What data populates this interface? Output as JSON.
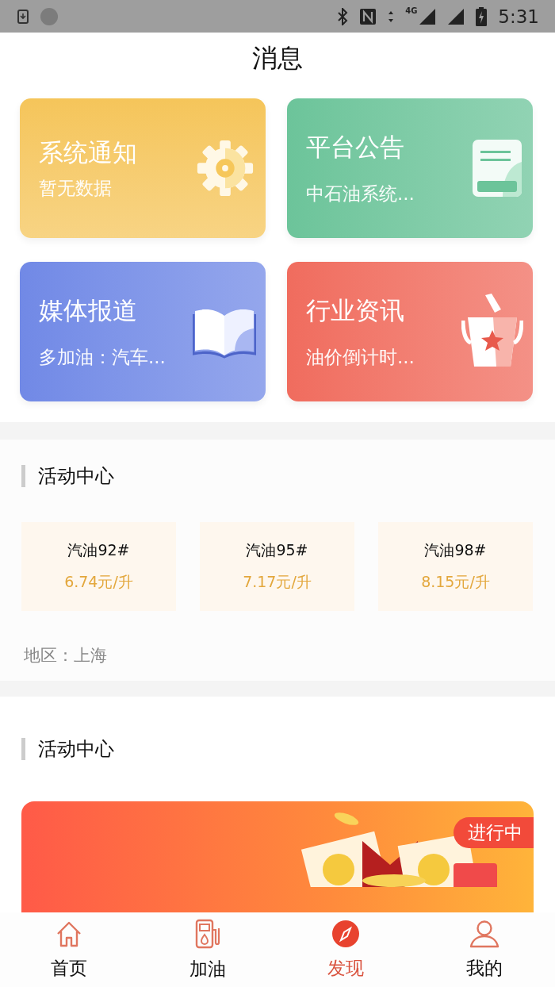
{
  "status_bar": {
    "network": "4G",
    "time": "5:31"
  },
  "title": "消息",
  "message_cards": [
    {
      "title": "系统通知",
      "subtitle": "暂无数据",
      "kind": "gear",
      "color": "#f5c55a"
    },
    {
      "title": "平台公告",
      "subtitle": "中石油系统...",
      "kind": "document",
      "color": "#6cc49a"
    },
    {
      "title": "媒体报道",
      "subtitle": "多加油：汽车...",
      "kind": "book",
      "color": "#7189e6"
    },
    {
      "title": "行业资讯",
      "subtitle": "油价倒计时...",
      "kind": "bucket",
      "color": "#f06c5e"
    }
  ],
  "fuel_section": {
    "heading": "活动中心",
    "prices": [
      {
        "grade": "汽油92#",
        "price": "6.74元/升"
      },
      {
        "grade": "汽油95#",
        "price": "7.17元/升"
      },
      {
        "grade": "汽油98#",
        "price": "8.15元/升"
      }
    ],
    "region": "地区：上海"
  },
  "activity_section": {
    "heading": "活动中心",
    "banner": {
      "badge": "进行中"
    }
  },
  "nav": [
    {
      "label": "首页",
      "kind": "home",
      "selected": false
    },
    {
      "label": "加油",
      "kind": "fuel",
      "selected": false
    },
    {
      "label": "发现",
      "kind": "compass",
      "selected": true
    },
    {
      "label": "我的",
      "kind": "person",
      "selected": false
    }
  ]
}
